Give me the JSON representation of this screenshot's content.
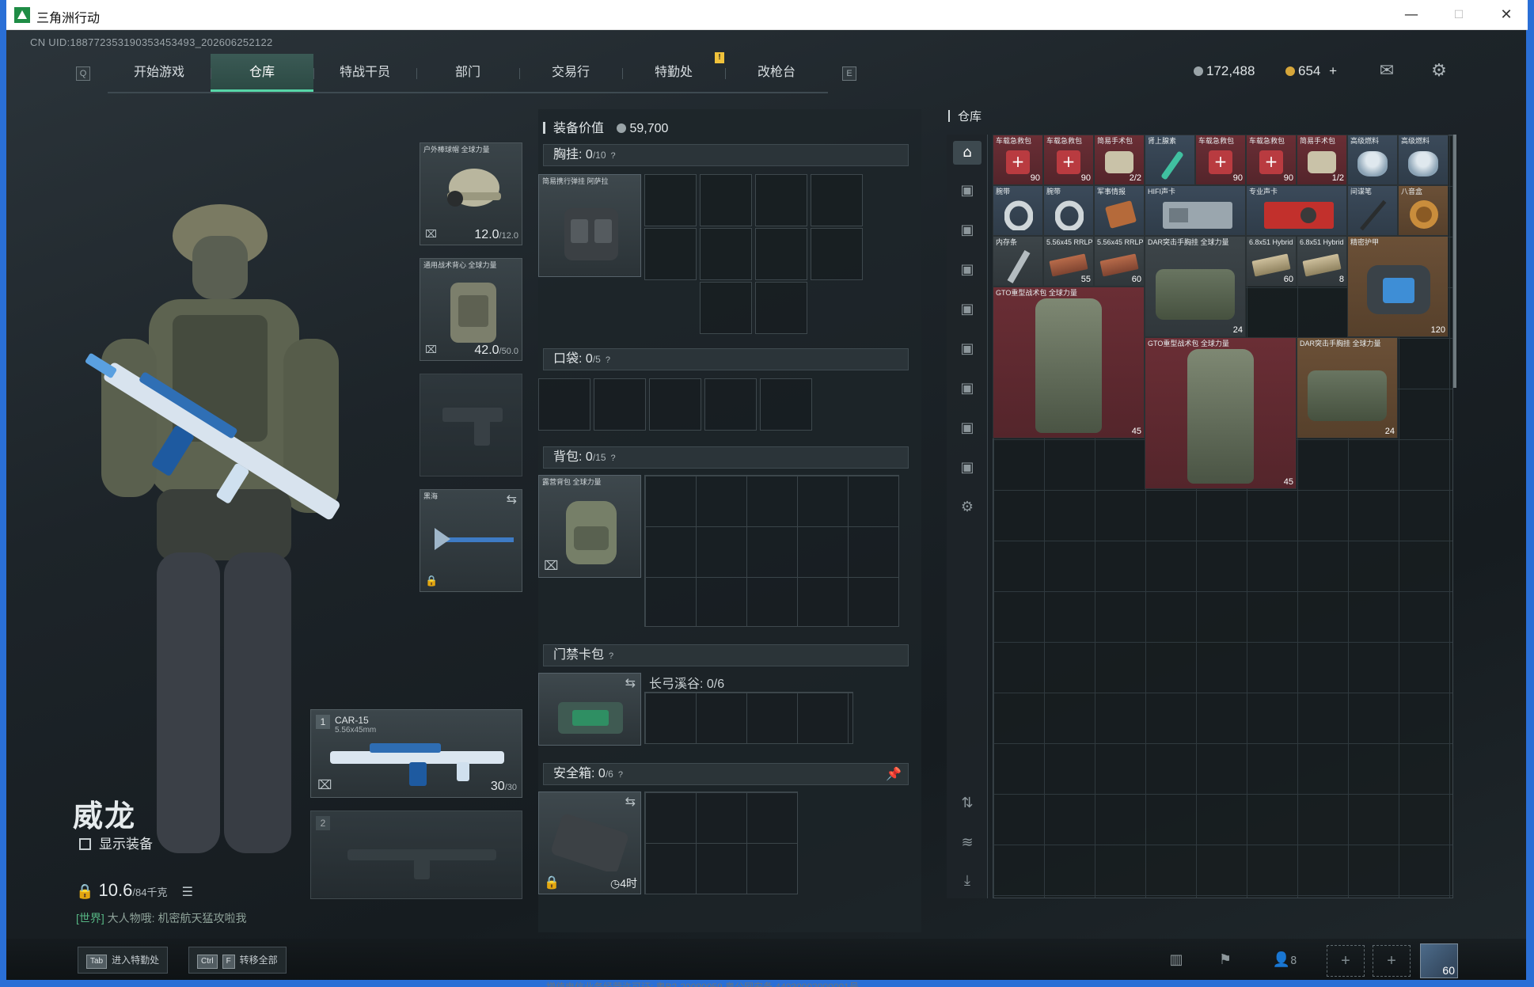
{
  "window": {
    "title": "三角洲行动",
    "minimize": "—",
    "maximize": "☐",
    "close": "✕"
  },
  "uid": "CN UID:18877235319035345349​3_202606252122",
  "nav": {
    "left_key": "Q",
    "right_key": "E",
    "items": [
      "开始游戏",
      "仓库",
      "特战干员",
      "部门",
      "交易行",
      "特勤处",
      "改枪台"
    ],
    "active": "仓库",
    "alert_mark": "!"
  },
  "currency": {
    "coins": "172,488",
    "gold": "654",
    "gold_add": "+"
  },
  "icons": {
    "mail": "mail-icon",
    "settings": "gear-icon"
  },
  "character": {
    "name": "威龙",
    "show_equipment": "显示装备",
    "weight_value": "10.6",
    "weight_max": "/84千克",
    "world_chat_tag": "[世界]",
    "world_chat_text": "大人物哦: 机密航天猛攻啦我"
  },
  "equip_slots": {
    "helmet": {
      "label": "户外棒球帽 全球力量",
      "value": "12.0",
      "max": "/12.0"
    },
    "armor": {
      "label": "通用战术背心 全球力量",
      "value": "42.0",
      "max": "/50.0"
    },
    "melee": {
      "label": "黑海"
    }
  },
  "weapons": {
    "primary": {
      "slot": "1",
      "name": "CAR-15",
      "caliber": "5.56x45mm",
      "ammo": "30",
      "ammo_max": "/30"
    },
    "secondary": {
      "slot": "2"
    }
  },
  "loadout": {
    "value_label": "装备价值",
    "value": "59,700",
    "chest": {
      "label": "胸挂:",
      "value": "0",
      "max": "/10",
      "item": "简易携行弹挂 阿萨拉"
    },
    "pockets": {
      "label": "口袋:",
      "value": "0",
      "max": "/5"
    },
    "backpack": {
      "label": "背包:",
      "value": "0",
      "max": "/15",
      "item": "露营背包 全球力量"
    },
    "keycard": {
      "label": "门禁卡包",
      "map": "长弓溪谷: 0/6"
    },
    "safebox": {
      "label": "安全箱:",
      "value": "0",
      "max": "/6",
      "timer": "4时"
    },
    "help": "?"
  },
  "stash": {
    "title": "仓库",
    "items": [
      {
        "label": "车载急救包",
        "count": "90"
      },
      {
        "label": "车载急救包",
        "count": "90"
      },
      {
        "label": "简易手术包",
        "count": "2/2"
      },
      {
        "label": "肾上腺素",
        "count": ""
      },
      {
        "label": "车载急救包",
        "count": "90"
      },
      {
        "label": "车载急救包",
        "count": "90"
      },
      {
        "label": "简易手术包",
        "count": "1/2"
      },
      {
        "label": "高级燃料",
        "count": ""
      },
      {
        "label": "高级燃料",
        "count": ""
      },
      {
        "label": "腕带",
        "count": ""
      },
      {
        "label": "腕带",
        "count": ""
      },
      {
        "label": "军事情报",
        "count": ""
      },
      {
        "label": "HIFI声卡",
        "count": ""
      },
      {
        "label": "专业声卡",
        "count": ""
      },
      {
        "label": "间谍笔",
        "count": ""
      },
      {
        "label": "八音盒",
        "count": ""
      },
      {
        "label": "内存条",
        "count": ""
      },
      {
        "label": "5.56x45 RRLP",
        "count": "55"
      },
      {
        "label": "5.56x45 RRLP",
        "count": "60"
      },
      {
        "label": "DAR突击手胸挂 全球力量",
        "count": "24"
      },
      {
        "label": "6.8x51 Hybrid",
        "count": "60"
      },
      {
        "label": "6.8x51 Hybrid",
        "count": "8"
      },
      {
        "label": "精密护甲",
        "count": "120"
      },
      {
        "label": "GTO重型战术包 全球力量",
        "count": "45"
      },
      {
        "label": "GTO重型战术包 全球力量",
        "count": "45"
      },
      {
        "label": "DAR突击手胸挂 全球力量",
        "count": "24"
      }
    ]
  },
  "bottom": {
    "hint1_key": "Tab",
    "hint1_text": "进入特勤处",
    "hint2_key1": "Ctrl",
    "hint2_key2": "F",
    "hint2_text": "转移全部",
    "squad_count": "8",
    "add": "+",
    "level": "60"
  },
  "footer": "增值电信业务经营许可证: 粤B2-20090059    粤公网安备 44030002000001号"
}
